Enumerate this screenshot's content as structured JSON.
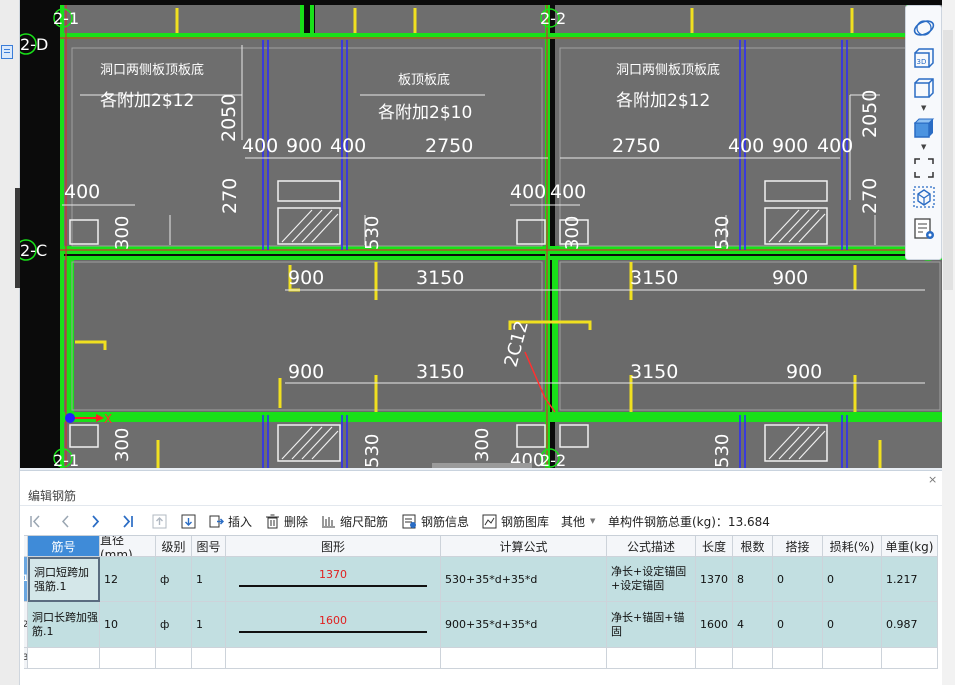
{
  "drawing": {
    "grid_labels": [
      "2-1",
      "2-2",
      "2-D",
      "2-C",
      "2-1",
      "2-2"
    ],
    "annotations_top_left": [
      "洞口两侧板顶板底",
      "各附加2$12"
    ],
    "annotations_top_mid": [
      "板顶板底",
      "各附加2$10"
    ],
    "annotations_top_right": [
      "洞口两侧板顶板底",
      "各附加2$12"
    ],
    "dims_row1": [
      "2050",
      "400",
      "900",
      "400",
      "2750",
      "2750",
      "400",
      "900",
      "400",
      "2050"
    ],
    "dims_row2": [
      "270",
      "400",
      "400",
      "400",
      "270"
    ],
    "dims_row3": [
      "300",
      "530",
      "530",
      "300"
    ],
    "dims_mid1": [
      "900",
      "3150",
      "3150",
      "900"
    ],
    "dims_mid2": [
      "900",
      "3150",
      "3150",
      "900"
    ],
    "rebar_label": "2C12",
    "dims_bottom": [
      "300",
      "530",
      "300",
      "400",
      "530"
    ],
    "axis_x_label": "X"
  },
  "side_toolbar": {
    "icons": [
      "rotate-icon",
      "view-3d-icon",
      "box-view-icon",
      "solid-view-icon",
      "fit-view-icon",
      "bind-view-icon",
      "display-settings-icon"
    ],
    "label_3d": "3D"
  },
  "panel": {
    "title": "编辑钢筋",
    "close": "×",
    "toolbar": {
      "first": "first-icon",
      "prev": "prev-icon",
      "next": "next-icon",
      "last": "last-icon",
      "move_up": "move-up-icon",
      "move_down": "move-down-icon",
      "insert": "插入",
      "delete": "删除",
      "scale": "缩尺配筋",
      "info": "钢筋信息",
      "library": "钢筋图库",
      "other": "其他",
      "total_weight": "单构件钢筋总重(kg)：13.684"
    },
    "columns": [
      "筋号",
      "直径(mm)",
      "级别",
      "图号",
      "图形",
      "计算公式",
      "公式描述",
      "长度",
      "根数",
      "搭接",
      "损耗(%)",
      "单重(kg)"
    ],
    "rows": [
      {
        "rn": "1",
        "name": "洞口短跨加强筋.1",
        "diameter": "12",
        "grade": "ф",
        "fig_no": "1",
        "shape_value": "1370",
        "formula": "530+35*d+35*d",
        "desc": "净长+设定锚固+设定锚固",
        "length": "1370",
        "count": "8",
        "lap": "0",
        "loss": "0",
        "unit_weight": "1.217"
      },
      {
        "rn": "2",
        "name": "洞口长跨加强筋.1",
        "diameter": "10",
        "grade": "ф",
        "fig_no": "1",
        "shape_value": "1600",
        "formula": "900+35*d+35*d",
        "desc": "净长+锚固+锚固",
        "length": "1600",
        "count": "4",
        "lap": "0",
        "loss": "0",
        "unit_weight": "0.987"
      }
    ],
    "empty_row_number": "3"
  }
}
